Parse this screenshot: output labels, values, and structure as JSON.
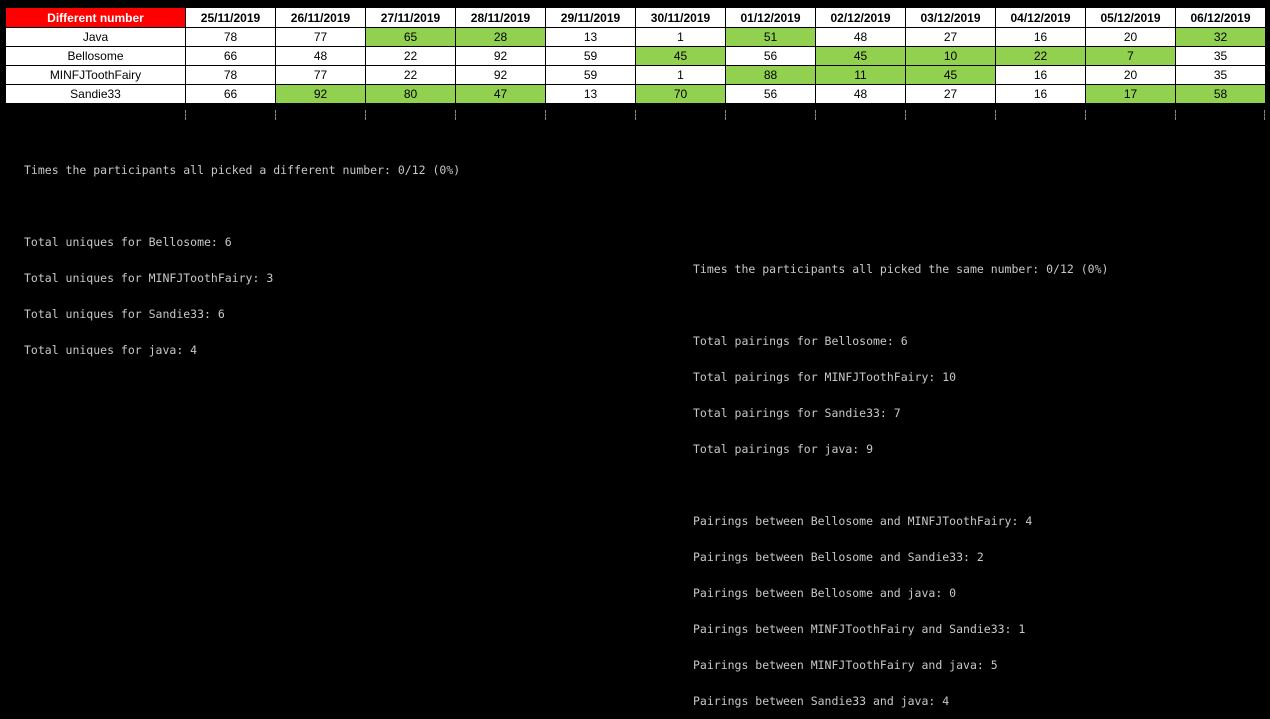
{
  "table": {
    "corner_label": "Different number",
    "dates": [
      "25/11/2019",
      "26/11/2019",
      "27/11/2019",
      "28/11/2019",
      "29/11/2019",
      "30/11/2019",
      "01/12/2019",
      "02/12/2019",
      "03/12/2019",
      "04/12/2019",
      "05/12/2019",
      "06/12/2019"
    ],
    "highlight_color": "#92d050",
    "corner_color": "#ff0000",
    "rows": [
      {
        "name": "Java",
        "values": [
          "78",
          "77",
          "65",
          "28",
          "13",
          "1",
          "51",
          "48",
          "27",
          "16",
          "20",
          "32"
        ],
        "highlighted": [
          false,
          false,
          true,
          true,
          false,
          false,
          true,
          false,
          false,
          false,
          false,
          true
        ]
      },
      {
        "name": "Bellosome",
        "values": [
          "66",
          "48",
          "22",
          "92",
          "59",
          "45",
          "56",
          "45",
          "10",
          "22",
          "7",
          "35"
        ],
        "highlighted": [
          false,
          false,
          false,
          false,
          false,
          true,
          false,
          true,
          true,
          true,
          true,
          false
        ]
      },
      {
        "name": "MINFJToothFairy",
        "values": [
          "78",
          "77",
          "22",
          "92",
          "59",
          "1",
          "88",
          "11",
          "45",
          "16",
          "20",
          "35"
        ],
        "highlighted": [
          false,
          false,
          false,
          false,
          false,
          false,
          true,
          true,
          true,
          false,
          false,
          false
        ]
      },
      {
        "name": "Sandie33",
        "values": [
          "66",
          "92",
          "80",
          "47",
          "13",
          "70",
          "56",
          "48",
          "27",
          "16",
          "17",
          "58"
        ],
        "highlighted": [
          false,
          true,
          true,
          true,
          false,
          true,
          false,
          false,
          false,
          false,
          true,
          true
        ]
      }
    ]
  },
  "console_left": {
    "different_summary": "Times the participants all picked a different number: 0/12 (0%)",
    "uniques": [
      "Total uniques for Bellosome: 6",
      "Total uniques for MINFJToothFairy: 3",
      "Total uniques for Sandie33: 6",
      "Total uniques for java: 4"
    ]
  },
  "console_right": {
    "same_summary": "Times the participants all picked the same number: 0/12 (0%)",
    "pairings_totals": [
      "Total pairings for Bellosome: 6",
      "Total pairings for MINFJToothFairy: 10",
      "Total pairings for Sandie33: 7",
      "Total pairings for java: 9"
    ],
    "pairings_between": [
      "Pairings between Bellosome and MINFJToothFairy: 4",
      "Pairings between Bellosome and Sandie33: 2",
      "Pairings between Bellosome and java: 0",
      "Pairings between MINFJToothFairy and Sandie33: 1",
      "Pairings between MINFJToothFairy and java: 5",
      "Pairings between Sandie33 and java: 4"
    ]
  }
}
